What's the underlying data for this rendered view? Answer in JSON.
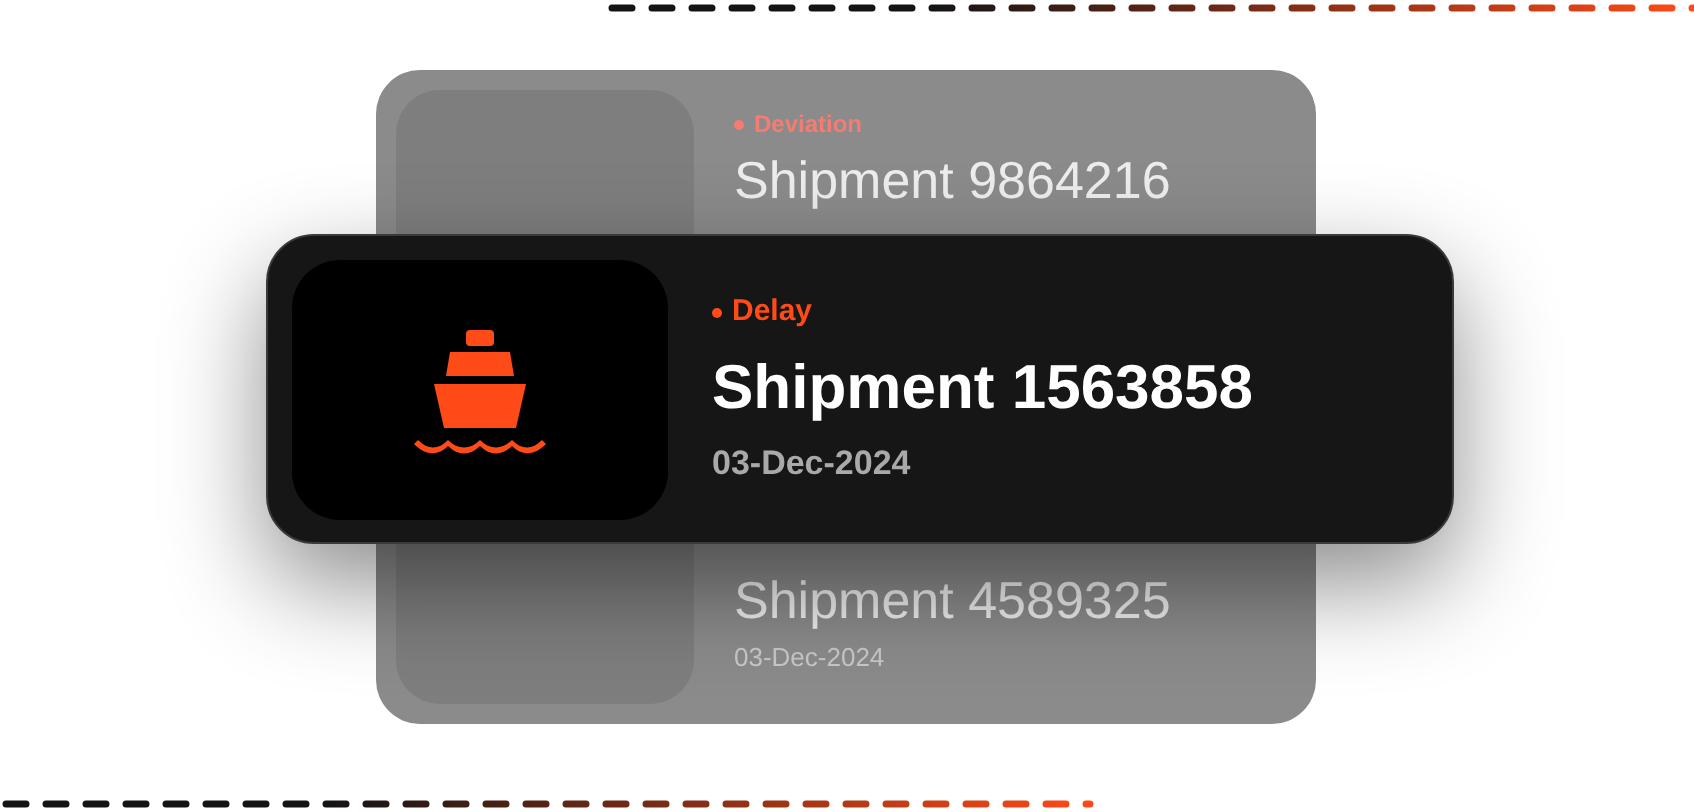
{
  "shipments": [
    {
      "status": {
        "label": "Deviation",
        "color": "#f47c72"
      },
      "title": "Shipment 9864216",
      "selected": false
    },
    {
      "status": {
        "label": "Delay",
        "color": "#ff4b17"
      },
      "title": "Shipment 1563858",
      "date": "03-Dec-2024",
      "selected": true
    },
    {
      "title": "Shipment 4589325",
      "date": "03-Dec-2024",
      "selected": false
    }
  ]
}
